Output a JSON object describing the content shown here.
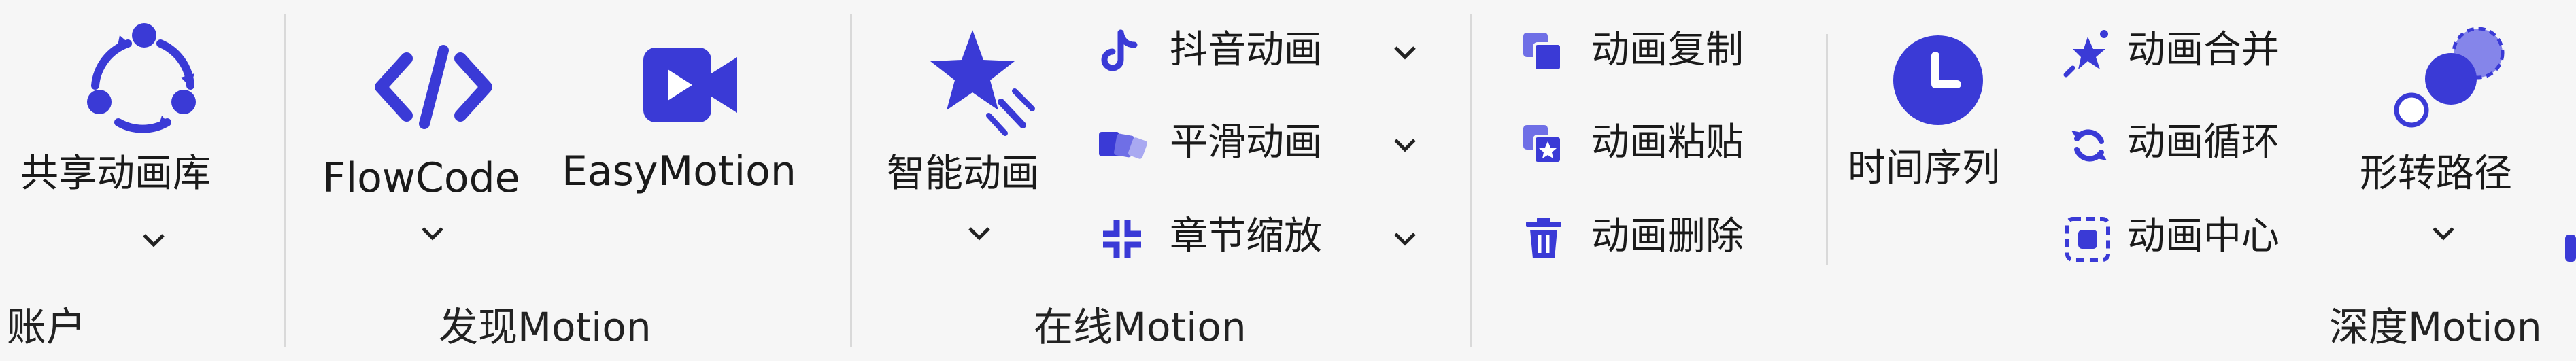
{
  "accent": "#3a3ad6",
  "groups": {
    "account": "账户",
    "discover": "发现Motion",
    "online": "在线Motion",
    "depth": "深度Motion"
  },
  "buttons": {
    "shared_library": "共享动画库",
    "flowcode": "FlowCode",
    "easymotion": "EasyMotion",
    "smart_animation": "智能动画",
    "tiktok_animation": "抖音动画",
    "smooth_animation": "平滑动画",
    "chapter_zoom": "章节缩放",
    "copy_animation": "动画复制",
    "paste_animation": "动画粘贴",
    "delete_animation": "动画删除",
    "time_sequence": "时间序列",
    "merge_animation": "动画合并",
    "loop_animation": "动画循环",
    "center_animation": "动画中心",
    "morph_path": "形转路径"
  }
}
